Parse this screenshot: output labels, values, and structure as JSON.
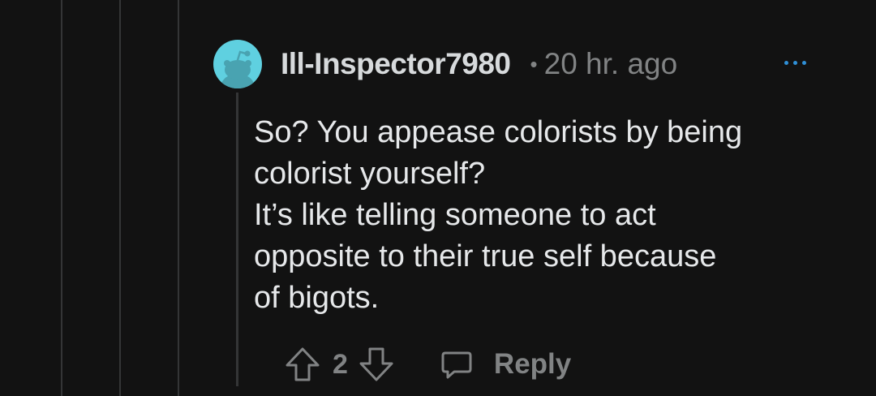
{
  "comment": {
    "username": "Ill-Inspector7980",
    "separator": "•",
    "timestamp": "20 hr. ago",
    "body_lines": [
      "So? You appease colorists by being",
      "colorist yourself?",
      "It’s like telling someone to act",
      "opposite to their true self because",
      "of bigots."
    ],
    "score": "2",
    "reply_label": "Reply"
  },
  "icons": {
    "avatar": "reddit-snoo-avatar-icon",
    "more": "more-options-icon",
    "upvote": "upvote-arrow-icon",
    "downvote": "downvote-arrow-icon",
    "reply": "speech-bubble-icon"
  },
  "colors": {
    "background": "#121212",
    "avatar_background": "#5fd0e0",
    "accent": "#2f8fd6",
    "muted_text": "#818384"
  }
}
